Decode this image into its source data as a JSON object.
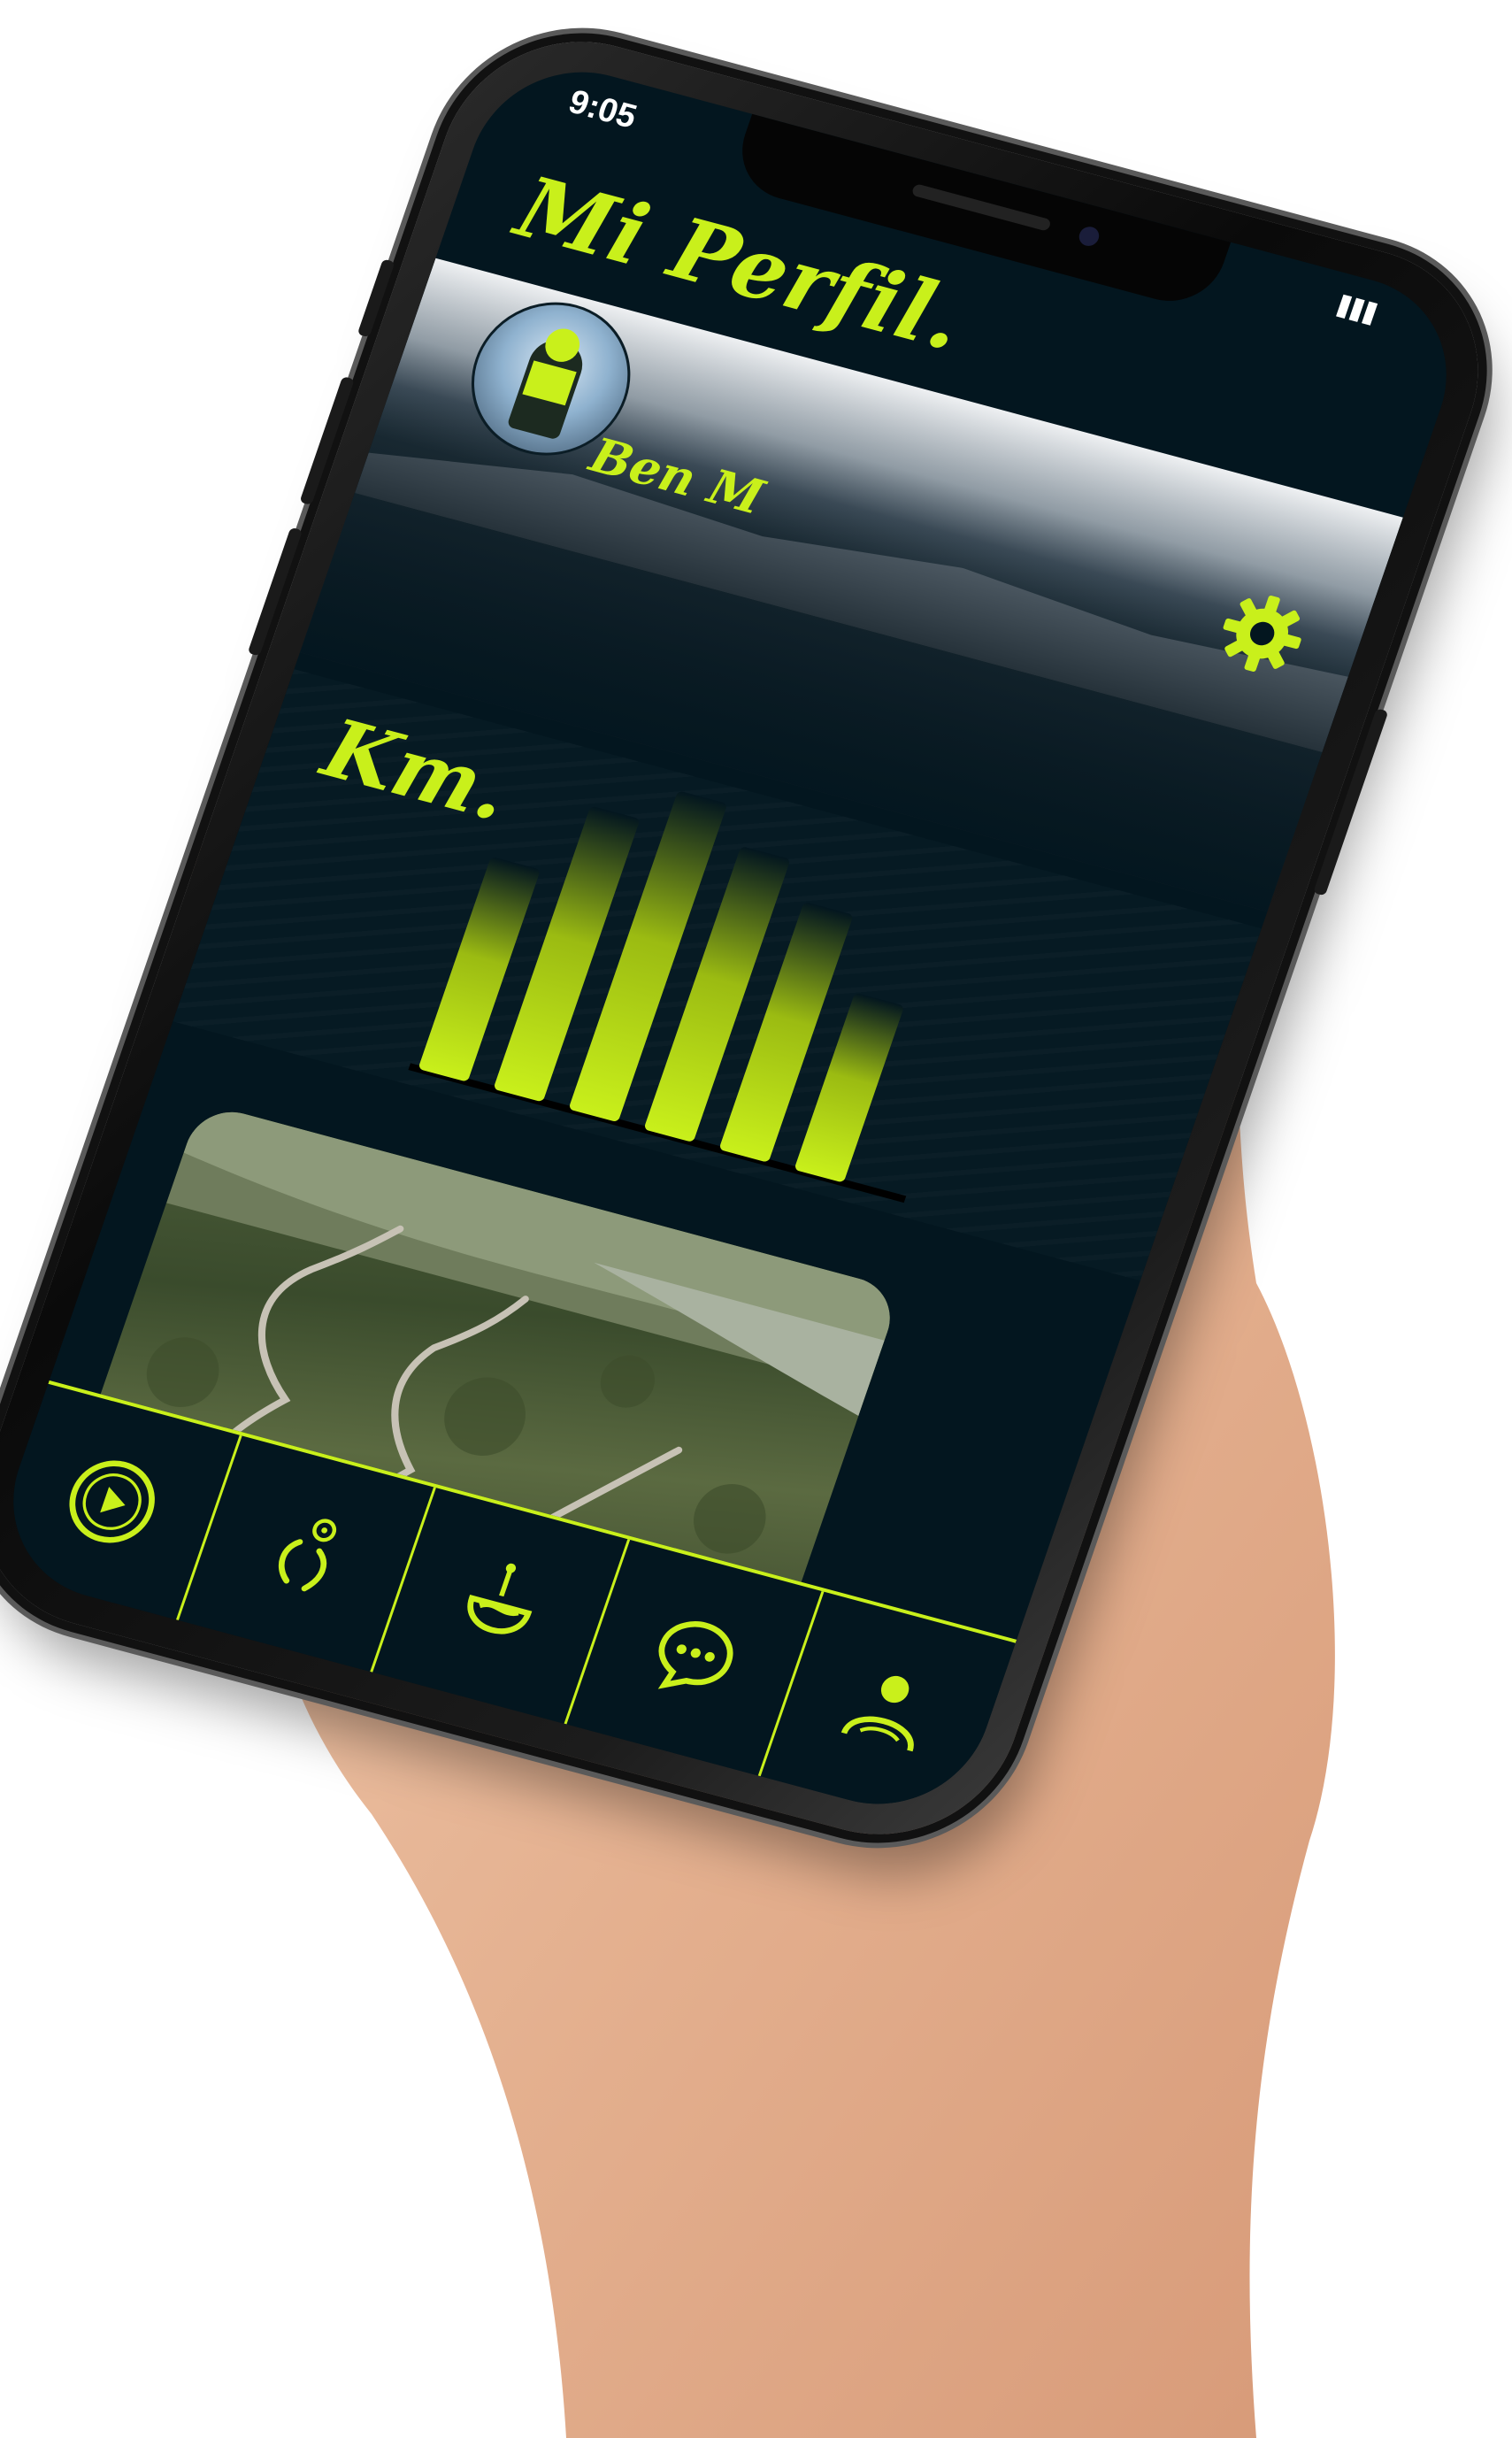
{
  "status_bar": {
    "time": "9:05"
  },
  "header": {
    "title": "Mi Perfil.",
    "user_name": "Ben M"
  },
  "icons": {
    "settings": "gear-icon",
    "avatar": "avatar",
    "nav": [
      "play-circle-icon",
      "activity-icon",
      "mountain-bike-icon",
      "chat-icon",
      "profile-icon"
    ]
  },
  "chart_data": {
    "type": "bar",
    "title": "Km.",
    "categories": [
      "",
      "",
      "",
      "",
      "",
      ""
    ],
    "values": [
      6,
      8,
      9,
      8,
      7,
      5
    ],
    "bar_color": "#c9f01b",
    "grid": false
  },
  "colors": {
    "accent": "#c9f01b",
    "background": "#03161f"
  }
}
